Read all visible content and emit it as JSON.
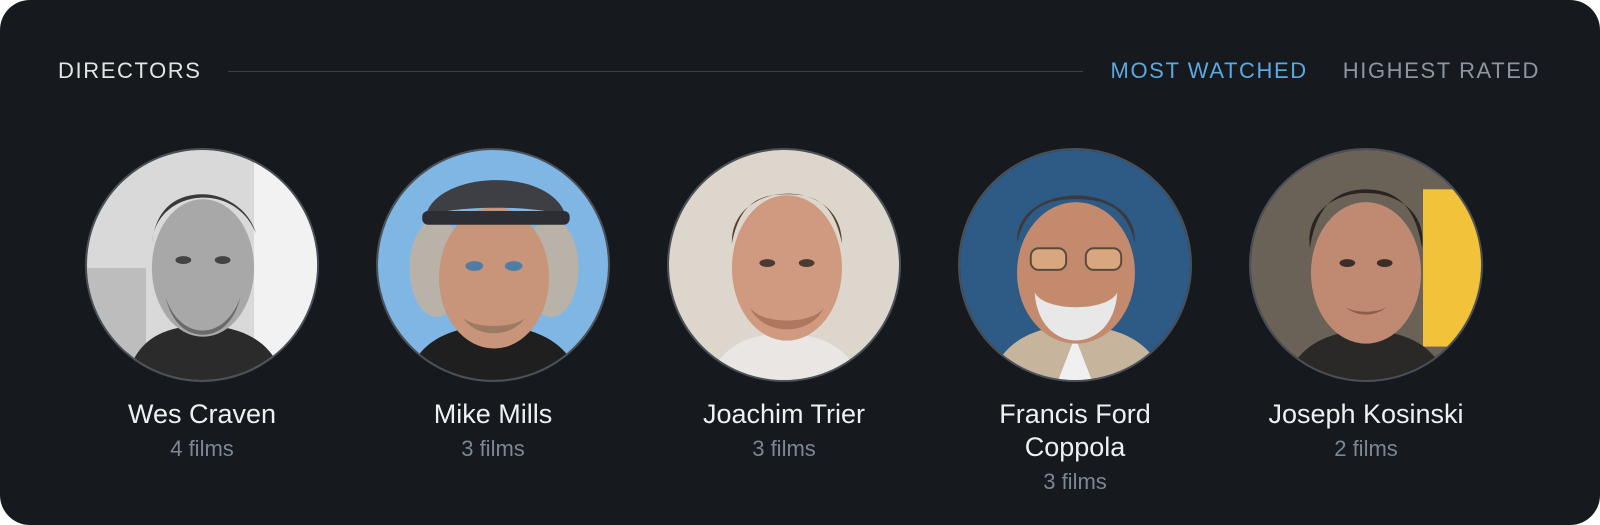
{
  "section": {
    "title": "DIRECTORS",
    "tabs": [
      {
        "label": "MOST WATCHED",
        "active": true
      },
      {
        "label": "HIGHEST RATED",
        "active": false
      }
    ]
  },
  "directors": [
    {
      "name": "Wes Craven",
      "count": "4 films",
      "photo": "portrait-bw-icon"
    },
    {
      "name": "Mike Mills",
      "count": "3 films",
      "photo": "portrait-cap-icon"
    },
    {
      "name": "Joachim Trier",
      "count": "3 films",
      "photo": "portrait-icon"
    },
    {
      "name": "Francis Ford Coppola",
      "count": "3 films",
      "photo": "portrait-glasses-icon"
    },
    {
      "name": "Joseph Kosinski",
      "count": "2 films",
      "photo": "portrait-icon"
    }
  ],
  "colors": {
    "background": "#16191d",
    "accent": "#5aa9e0",
    "muted": "#8c96a3"
  }
}
